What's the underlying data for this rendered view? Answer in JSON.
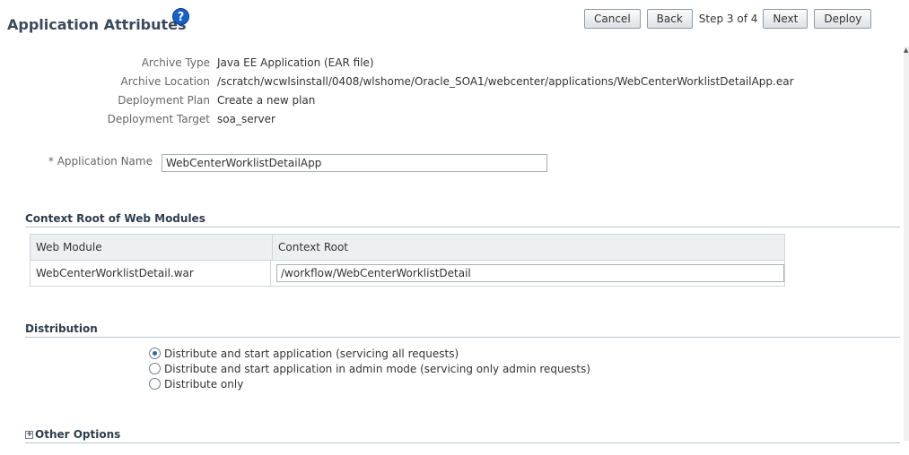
{
  "header": {
    "title": "Application Attributes",
    "help_icon": "?",
    "buttons": {
      "cancel": "Cancel",
      "back": "Back",
      "step": "Step 3 of 4",
      "next": "Next",
      "deploy": "Deploy"
    }
  },
  "archive": {
    "type_label": "Archive Type",
    "type_value": "Java EE Application (EAR file)",
    "location_label": "Archive Location",
    "location_value": "/scratch/wcwlsinstall/0408/wlshome/Oracle_SOA1/webcenter/applications/WebCenterWorklistDetailApp.ear",
    "plan_label": "Deployment Plan",
    "plan_value": "Create a new plan",
    "target_label": "Deployment Target",
    "target_value": "soa_server"
  },
  "app_name": {
    "label": "* Application Name",
    "value": "WebCenterWorklistDetailApp"
  },
  "context_root": {
    "heading": "Context Root of Web Modules",
    "columns": [
      "Web Module",
      "Context Root"
    ],
    "rows": [
      {
        "module": "WebCenterWorklistDetail.war",
        "context": "/workflow/WebCenterWorklistDetail"
      }
    ]
  },
  "distribution": {
    "heading": "Distribution",
    "options": [
      {
        "label": "Distribute and start application (servicing all requests)",
        "checked": true
      },
      {
        "label": "Distribute and start application in admin mode (servicing only admin requests)",
        "checked": false
      },
      {
        "label": "Distribute only",
        "checked": false
      }
    ]
  },
  "other_options": {
    "expand_icon": "+",
    "heading": "Other Options"
  }
}
